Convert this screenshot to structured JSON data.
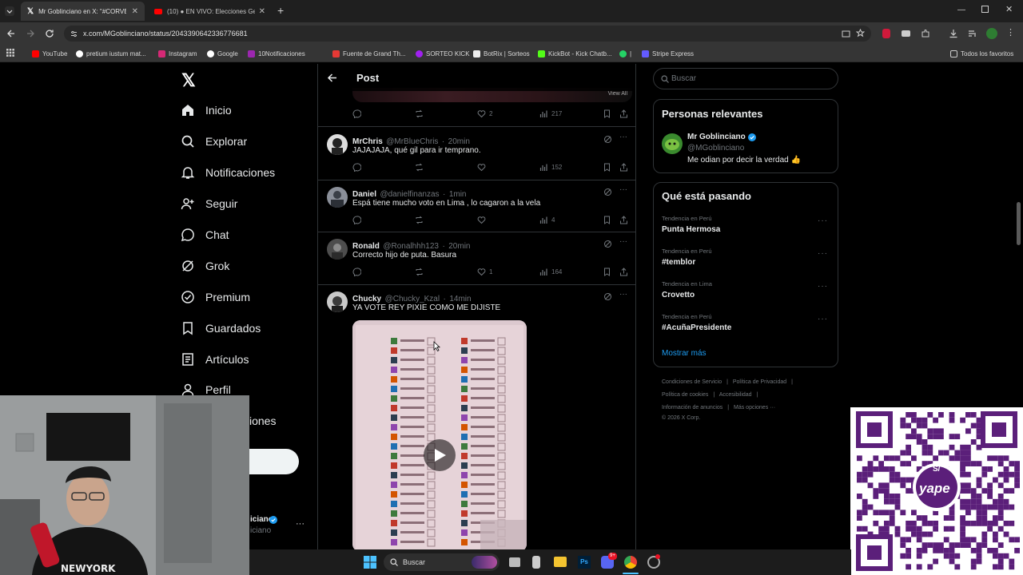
{
  "browser": {
    "tabs": [
      {
        "title": "Mr Goblinciano en X: \"#CORVE",
        "active": true
      },
      {
        "title": "(10) ● EN VIVO: Elecciones Ge",
        "active": false
      }
    ],
    "new_tab": "+",
    "url": "x.com/MGoblinciano/status/2043390642336776681",
    "bookmarks": [
      "YouTube",
      "pretium iustum mat...",
      "Instagram",
      "Google",
      "10Notificaciones",
      "Fuente de Grand Th...",
      "SORTEO KICK",
      "BotRix | Sorteos",
      "KickBot - Kick Chatb...",
      "|",
      "Stripe Express"
    ],
    "all_bookmarks": "Todos los favoritos"
  },
  "nav": {
    "items": [
      "Inicio",
      "Explorar",
      "Notificaciones",
      "Seguir",
      "Chat",
      "Grok",
      "Premium",
      "Guardados",
      "Artículos",
      "Perfil"
    ],
    "more_partial": "iones",
    "account_name_partial": "iciano",
    "account_handle_partial": "iciano"
  },
  "post_header": {
    "title": "Post"
  },
  "top_actions": {
    "likes": "2",
    "views": "217",
    "media_badge": "View All"
  },
  "replies": [
    {
      "name": "MrChris",
      "handle": "@MrBlueChris",
      "time": "20min",
      "text": "JAJAJAJA, qué gil para ir temprano.",
      "likes": "",
      "views": "152"
    },
    {
      "name": "Daniel",
      "handle": "@danielfinanzas",
      "time": "1min",
      "text": "Espá tiene mucho voto en Lima , lo cagaron a la vela",
      "likes": "",
      "views": "4"
    },
    {
      "name": "Ronald",
      "handle": "@Ronalhhh123",
      "time": "20min",
      "text": "Correcto hijo de puta. Basura",
      "likes": "1",
      "views": "164"
    },
    {
      "name": "Chucky",
      "handle": "@Chucky_Kzal",
      "time": "14min",
      "text": "YA VOTE REY PIXIE COMO ME DIJISTE",
      "likes": "",
      "views": ""
    }
  ],
  "right": {
    "search_placeholder": "Buscar",
    "relevant_title": "Personas relevantes",
    "relevant_person": {
      "name": "Mr Goblinciano",
      "handle": "@MGoblinciano",
      "bio": "Me odian por decir la verdad 👍"
    },
    "trending_title": "Qué está pasando",
    "trends": [
      {
        "category": "Tendencia en Perú",
        "name": "Punta Hermosa"
      },
      {
        "category": "Tendencia en Perú",
        "name": "#temblor"
      },
      {
        "category": "Tendencia en Lima",
        "name": "Crovetto"
      },
      {
        "category": "Tendencia en Perú",
        "name": "#AcuñaPresidente"
      }
    ],
    "show_more": "Mostrar más",
    "footer": [
      "Condiciones de Servicio",
      "Política de Privacidad",
      "Política de cookies",
      "Accesibilidad",
      "Información de anuncios",
      "Más opciones ···",
      "© 2026 X Corp."
    ]
  },
  "taskbar": {
    "search": "Buscar",
    "ps": "Ps",
    "badge": "9+"
  },
  "qr": {
    "brand": "yape",
    "symbol": "S/"
  },
  "colors": {
    "accent": "#1d9bf0",
    "verified": "#1d9bf0",
    "border": "#2f3336",
    "muted": "#71767b",
    "yape": "#5b1f7a"
  }
}
